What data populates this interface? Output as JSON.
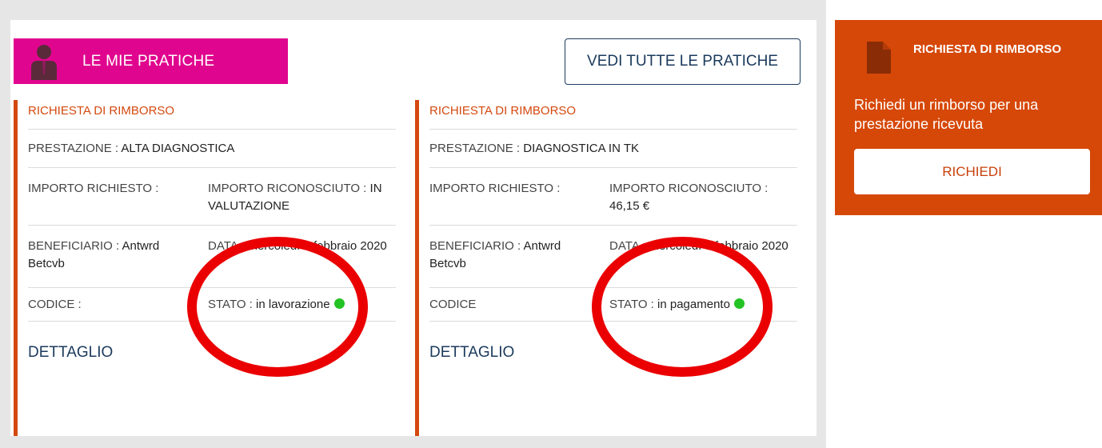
{
  "header": {
    "title": "LE MIE PRATICHE",
    "icon": "user-icon",
    "color": "#e0058e",
    "view_all_label": "VEDI TUTTE LE PRATICHE"
  },
  "cards": [
    {
      "type": "RICHIESTA DI RIMBORSO",
      "prestazione_label": "PRESTAZIONE :",
      "prestazione_value": "ALTA DIAGNOSTICA",
      "importo_richiesto_label": "IMPORTO RICHIESTO :",
      "importo_richiesto_value": "",
      "importo_riconosciuto_label": "IMPORTO RICONOSCIUTO :",
      "importo_riconosciuto_value": "IN VALUTAZIONE",
      "beneficiario_label": "BENEFICIARIO :",
      "beneficiario_value": "Antwrd Betcvb",
      "data_label": "DATA :",
      "data_value": "mercoledì 5 febbraio 2020",
      "codice_label": "CODICE :",
      "codice_value": "",
      "stato_label": "STATO :",
      "stato_value": "in lavorazione",
      "stato_color": "#22c322",
      "detail_label": "DETTAGLIO"
    },
    {
      "type": "RICHIESTA DI RIMBORSO",
      "prestazione_label": "PRESTAZIONE :",
      "prestazione_value": "DIAGNOSTICA IN TK",
      "importo_richiesto_label": "IMPORTO RICHIESTO :",
      "importo_richiesto_value": "",
      "importo_riconosciuto_label": "IMPORTO RICONOSCIUTO :",
      "importo_riconosciuto_value": "46,15 €",
      "beneficiario_label": "BENEFICIARIO :",
      "beneficiario_value": "Antwrd Betcvb",
      "data_label": "DATA :",
      "data_value": "mercoledì 5 febbraio 2020",
      "codice_label": "CODICE",
      "codice_value": "",
      "stato_label": "STATO :",
      "stato_value": "in pagamento",
      "stato_color": "#22c322",
      "detail_label": "DETTAGLIO"
    }
  ],
  "sidebar": {
    "title": "RICHIESTA DI RIMBORSO",
    "icon": "document-icon",
    "description": "Richiedi un rimborso per una prestazione ricevuta",
    "button_label": "RICHIEDI",
    "color": "#d64808"
  },
  "annotations": {
    "highlight_color": "#ea0000"
  }
}
